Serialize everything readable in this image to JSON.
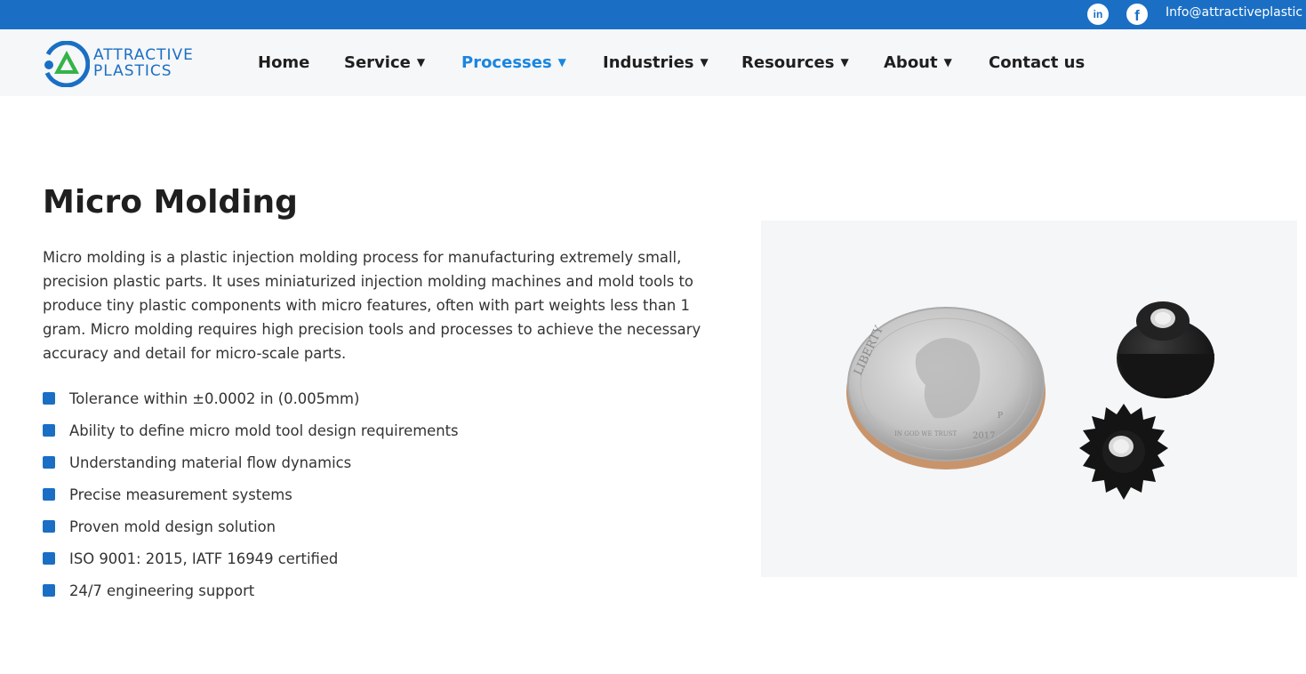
{
  "topbar": {
    "linkedin_icon": "linkedin-icon",
    "linkedin_glyph": "in",
    "facebook_icon": "facebook-icon",
    "facebook_glyph": "f",
    "email": "Info@attractiveplastic"
  },
  "logo": {
    "line1": "ATTRACTIVE",
    "line2": "PLASTICS"
  },
  "nav": {
    "items": [
      {
        "label": "Home",
        "caret": ""
      },
      {
        "label": "Service",
        "caret": "▼"
      },
      {
        "label": "Processes",
        "caret": "▼"
      },
      {
        "label": "Industries",
        "caret": "▼"
      },
      {
        "label": "Resources",
        "caret": "▼"
      },
      {
        "label": "About",
        "caret": "▼"
      },
      {
        "label": "Contact us",
        "caret": ""
      }
    ],
    "active": "Processes"
  },
  "main": {
    "title": "Micro Molding",
    "description": "Micro molding is a plastic injection molding process for manufacturing extremely small, precision plastic parts. It uses miniaturized injection molding machines and mold tools to produce tiny plastic components with micro features, often with part weights less than 1 gram. Micro molding requires high precision tools and processes to achieve the necessary accuracy and detail for micro-scale parts.",
    "features": [
      "Tolerance within ±0.0002 in (0.005mm)",
      "Ability to define micro mold tool design requirements",
      "Understanding material flow dynamics",
      "Precise measurement systems",
      "Proven mold design solution",
      "ISO 9001: 2015, IATF 16949 certified",
      "24/7 engineering support"
    ]
  },
  "photo": {
    "coin_text_1": "LIBERTY",
    "coin_text_2": "IN GOD WE TRUST",
    "coin_year": "2017",
    "coin_mint": "P"
  },
  "colors": {
    "brand_blue": "#1a6fc4",
    "active_nav": "#1a86e0",
    "logo_green": "#34b34a"
  }
}
